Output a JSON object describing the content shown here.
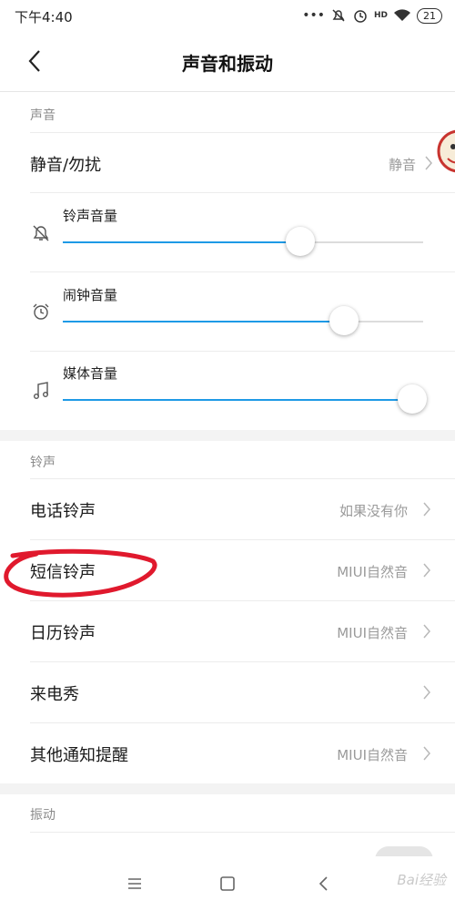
{
  "status_bar": {
    "time": "下午4:40",
    "battery": "21",
    "network_label": "HD"
  },
  "header": {
    "title": "声音和振动"
  },
  "sections": {
    "sound_header": "声音",
    "ringtone_header": "铃声",
    "vibration_header": "振动"
  },
  "silent_row": {
    "label": "静音/勿扰",
    "value": "静音"
  },
  "volumes": {
    "ringer": {
      "label": "铃声音量",
      "level": 0.66
    },
    "alarm": {
      "label": "闹钟音量",
      "level": 0.78
    },
    "media": {
      "label": "媒体音量",
      "level": 0.97
    }
  },
  "ringtones": [
    {
      "label": "电话铃声",
      "value": "如果没有你"
    },
    {
      "label": "短信铃声",
      "value": "MIUI自然音"
    },
    {
      "label": "日历铃声",
      "value": "MIUI自然音"
    },
    {
      "label": "来电秀",
      "value": ""
    },
    {
      "label": "其他通知提醒",
      "value": "MIUI自然音"
    }
  ],
  "colors": {
    "accent": "#1e9ae6",
    "annotation": "#e0192d"
  },
  "watermark": "Bai经验",
  "icons": [
    "back-arrow-icon",
    "bell-off-icon",
    "alarm-clock-icon",
    "music-note-icon",
    "chevron-right-icon",
    "wifi-icon",
    "menu-icon",
    "home-square-icon",
    "back-nav-icon"
  ]
}
